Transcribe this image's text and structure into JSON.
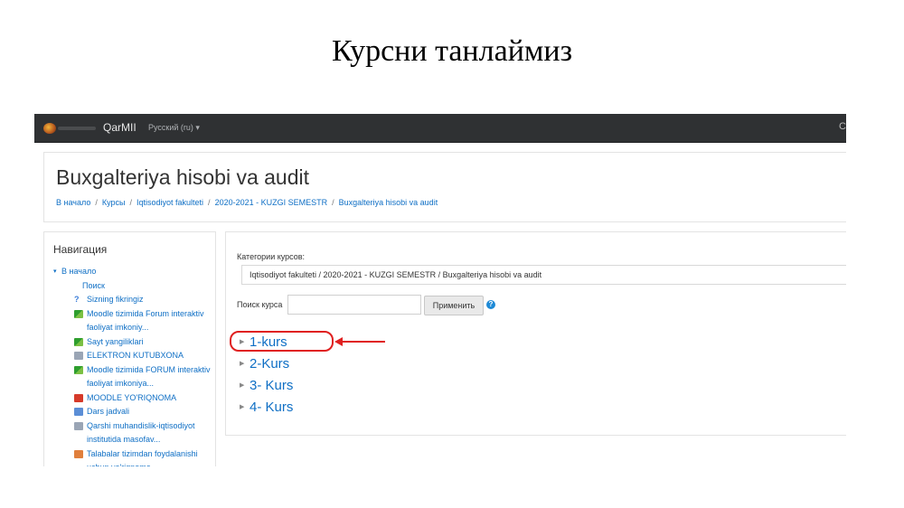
{
  "slide": {
    "title": "Курсни танлаймиз"
  },
  "navbar": {
    "brand": "QarMII",
    "language": "Русский (ru) ▾",
    "right_text": "C"
  },
  "course": {
    "title": "Buxgalteriya hisobi va audit"
  },
  "breadcrumb": [
    "В начало",
    "Курсы",
    "Iqtisodiyot fakulteti",
    "2020-2021 - KUZGI SEMESTR",
    "Buxgalteriya hisobi va audit"
  ],
  "navigation": {
    "heading": "Навигация",
    "home": "В начало",
    "search": "Поиск",
    "items": [
      {
        "icon": "help-icon",
        "label": "Sizning fikringiz"
      },
      {
        "icon": "forum-icon",
        "label": "Moodle tizimida Forum interaktiv faoliyat imkoniy..."
      },
      {
        "icon": "forum-icon",
        "label": "Sayt yangiliklari"
      },
      {
        "icon": "file-icon",
        "label": "ELEKTRON KUTUBXONA"
      },
      {
        "icon": "forum-icon",
        "label": "Moodle tizimida FORUM interaktiv faoliyat imkoniya..."
      },
      {
        "icon": "pdf-icon",
        "label": "MOODLE YO'RIQNOMA"
      },
      {
        "icon": "folder-icon",
        "label": "Dars jadvali"
      },
      {
        "icon": "file-icon",
        "label": "Qarshi muhandislik-iqtisodiyot institutida masofav..."
      },
      {
        "icon": "doc-icon",
        "label": "Talabalar tizimdan foydalanishi uchun yo'riqnoma"
      }
    ]
  },
  "main": {
    "category_label": "Категории курсов:",
    "category_value": "Iqtisodiyot fakulteti / 2020-2021 - KUZGI SEMESTR / Buxgalteriya hisobi va audit",
    "search_label": "Поиск курса",
    "search_value": "",
    "apply_label": "Применить",
    "help": "?",
    "courses": [
      "1-kurs",
      "2-Kurs",
      "3- Kurs",
      "4- Kurs"
    ]
  },
  "annotation": {
    "highlight_color": "#e02020"
  },
  "colors": {
    "link": "#0f6fc5",
    "navbar": "#2f3133"
  }
}
